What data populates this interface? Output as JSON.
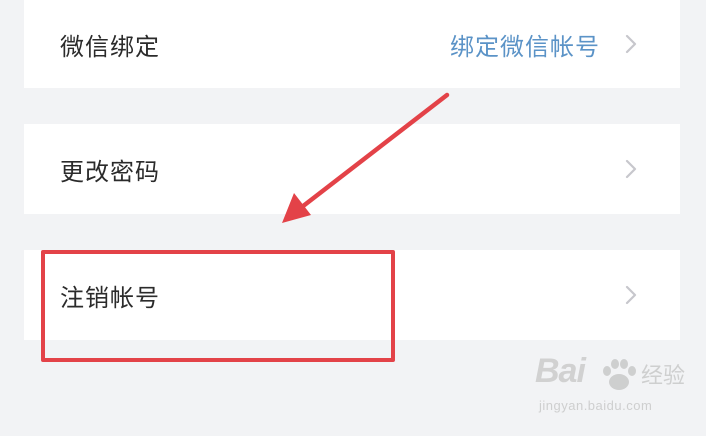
{
  "settings": {
    "rows": [
      {
        "label": "微信绑定",
        "value": "绑定微信帐号"
      },
      {
        "label": "更改密码"
      },
      {
        "label": "注销帐号"
      }
    ]
  },
  "watermark": {
    "logo": "Bai",
    "logo_icon": "paw-icon",
    "exp": "经验",
    "url": "jingyan.baidu.com"
  },
  "annotation": {
    "color": "#e34248",
    "target": "注销帐号"
  },
  "colors": {
    "background": "#f2f3f5",
    "row_bg": "#ffffff",
    "label": "#2b2b2b",
    "link": "#5b93c7",
    "chevron": "#c7c7cc",
    "highlight": "#e34248"
  }
}
